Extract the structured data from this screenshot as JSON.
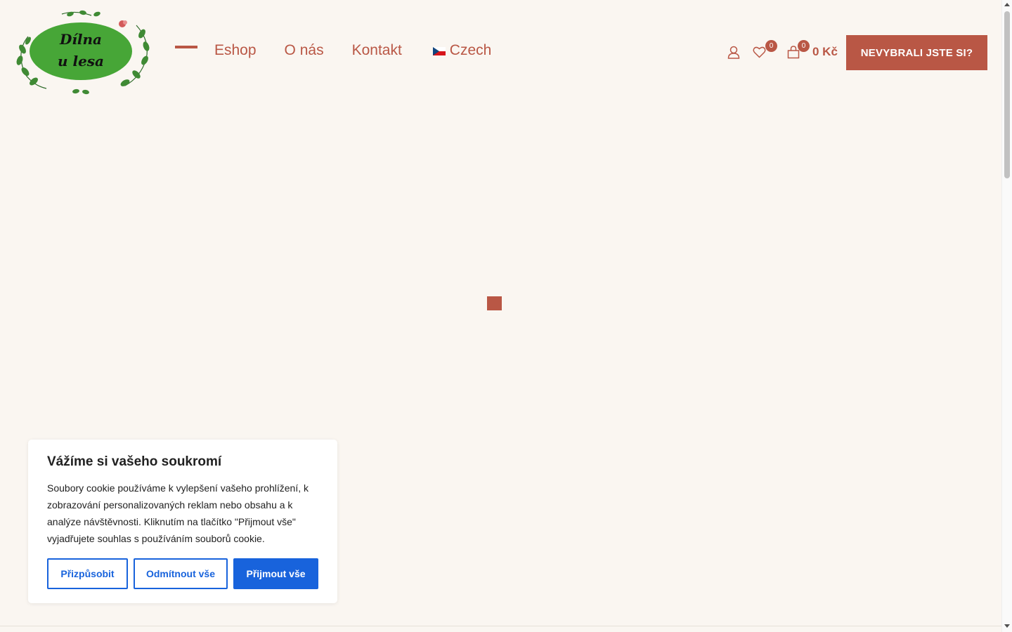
{
  "logo": {
    "text_line1": "Dílna",
    "text_line2": "u lesa"
  },
  "nav": {
    "items": [
      {
        "label": "Eshop"
      },
      {
        "label": "O nás"
      },
      {
        "label": "Kontakt"
      }
    ],
    "language": {
      "label": "Czech",
      "flag": "czech-flag-icon"
    }
  },
  "header_icons": {
    "account": "user-icon",
    "wishlist": {
      "icon": "heart-icon",
      "count": "0"
    },
    "cart": {
      "icon": "shopping-bag-icon",
      "count": "0",
      "total": "0 Kč"
    }
  },
  "cta": {
    "label": "NEVYBRALI JSTE SI?"
  },
  "cookie_banner": {
    "title": "Vážíme si vašeho soukromí",
    "text": "Soubory cookie používáme k vylepšení vašeho prohlížení, k zobrazování personalizovaných reklam nebo obsahu a k analýze návštěvnosti. Kliknutím na tlačítko \"Přijmout vše\" vyjadřujete souhlas s používáním souborů cookie.",
    "buttons": {
      "customize": "Přizpůsobit",
      "reject": "Odmítnout vše",
      "accept": "Přijmout vše"
    }
  },
  "colors": {
    "background": "#faf6f1",
    "accent": "#b95745",
    "cookie_button": "#1863dc",
    "logo_green": "#47a637"
  }
}
